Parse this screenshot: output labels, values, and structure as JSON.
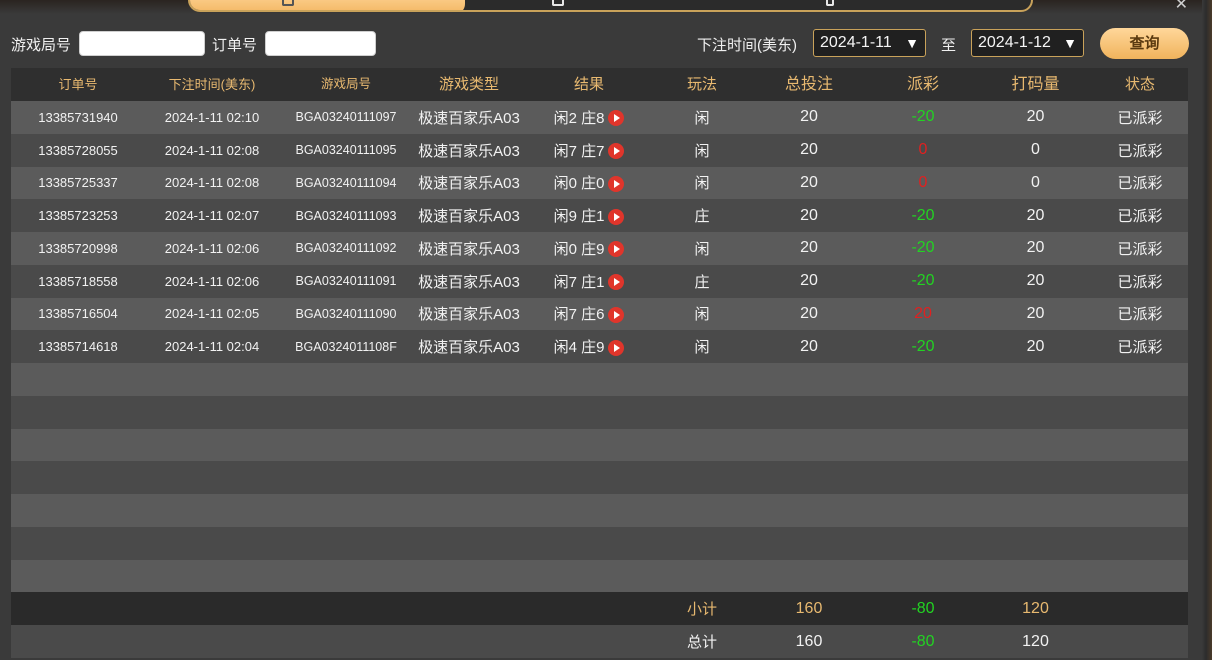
{
  "filters": {
    "game_round_label": "游戏局号",
    "game_round_value": "",
    "order_label": "订单号",
    "order_value": "",
    "bet_time_label": "下注时间(美东)",
    "date_from": "2024-1-11",
    "to_label": "至",
    "date_to": "2024-1-12",
    "query_label": "查询"
  },
  "table": {
    "headers": [
      "订单号",
      "下注时间(美东)",
      "游戏局号",
      "游戏类型",
      "结果",
      "玩法",
      "总投注",
      "派彩",
      "打码量",
      "状态"
    ],
    "rows": [
      {
        "order": "13385731940",
        "time": "2024-1-11 02:10",
        "round": "BGA03240111097",
        "type": "极速百家乐A03",
        "result": "闲2 庄8",
        "play": "闲",
        "bet": "20",
        "payout": "-20",
        "payout_color": "green",
        "wager": "20",
        "status": "已派彩"
      },
      {
        "order": "13385728055",
        "time": "2024-1-11 02:08",
        "round": "BGA03240111095",
        "type": "极速百家乐A03",
        "result": "闲7 庄7",
        "play": "闲",
        "bet": "20",
        "payout": "0",
        "payout_color": "red",
        "wager": "0",
        "status": "已派彩"
      },
      {
        "order": "13385725337",
        "time": "2024-1-11 02:08",
        "round": "BGA03240111094",
        "type": "极速百家乐A03",
        "result": "闲0 庄0",
        "play": "闲",
        "bet": "20",
        "payout": "0",
        "payout_color": "red",
        "wager": "0",
        "status": "已派彩"
      },
      {
        "order": "13385723253",
        "time": "2024-1-11 02:07",
        "round": "BGA03240111093",
        "type": "极速百家乐A03",
        "result": "闲9 庄1",
        "play": "庄",
        "bet": "20",
        "payout": "-20",
        "payout_color": "green",
        "wager": "20",
        "status": "已派彩"
      },
      {
        "order": "13385720998",
        "time": "2024-1-11 02:06",
        "round": "BGA03240111092",
        "type": "极速百家乐A03",
        "result": "闲0 庄9",
        "play": "闲",
        "bet": "20",
        "payout": "-20",
        "payout_color": "green",
        "wager": "20",
        "status": "已派彩"
      },
      {
        "order": "13385718558",
        "time": "2024-1-11 02:06",
        "round": "BGA03240111091",
        "type": "极速百家乐A03",
        "result": "闲7 庄1",
        "play": "庄",
        "bet": "20",
        "payout": "-20",
        "payout_color": "green",
        "wager": "20",
        "status": "已派彩"
      },
      {
        "order": "13385716504",
        "time": "2024-1-11 02:05",
        "round": "BGA03240111090",
        "type": "极速百家乐A03",
        "result": "闲7 庄6",
        "play": "闲",
        "bet": "20",
        "payout": "20",
        "payout_color": "red",
        "wager": "20",
        "status": "已派彩"
      },
      {
        "order": "13385714618",
        "time": "2024-1-11 02:04",
        "round": "BGA0324011108F",
        "type": "极速百家乐A03",
        "result": "闲4 庄9",
        "play": "闲",
        "bet": "20",
        "payout": "-20",
        "payout_color": "green",
        "wager": "20",
        "status": "已派彩"
      }
    ],
    "empty_rows": 7
  },
  "summary": {
    "subtotal": {
      "label": "小计",
      "bet": "160",
      "payout": "-80",
      "wager": "120"
    },
    "total": {
      "label": "总计",
      "bet": "160",
      "payout": "-80",
      "wager": "120"
    }
  },
  "colors": {
    "accent": "#e8b970",
    "button": "#f3b662",
    "loss_green": "#22d322",
    "win_red": "#e02020"
  },
  "icons": {
    "replay": "play-icon",
    "dropdown": "chevron-down-icon",
    "close": "close-icon"
  }
}
